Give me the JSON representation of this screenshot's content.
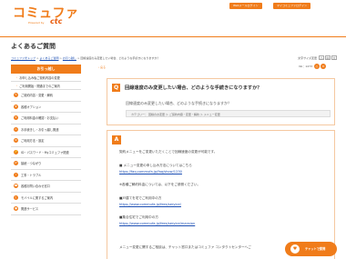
{
  "header": {
    "logo_text": "コミュファ",
    "logo_sub": "Powered by",
    "logo_ctc": "ctc",
    "link_web": "Webメールログイン",
    "link_commufa": "マイコミュファログイン"
  },
  "page_title": "よくあるご質問",
  "breadcrumb": {
    "items": [
      "コミュファ光トップ",
      "よくあるご質問",
      "お引っ越し",
      "回線速度のみ変更したい場合、どのような手続きになりますか？"
    ],
    "font_size_label": "文字サイズ変更",
    "fs_small": "小",
    "fs_mid": "中",
    "fs_large": "大"
  },
  "sidebar": {
    "heading": "お引っ越し",
    "items": [
      {
        "label": "お申し込み後ご契約内容の変更",
        "sub": true
      },
      {
        "label": "ご利用開始・開通までのご案内",
        "sub": true
      },
      {
        "label": "ご契約内容・変更・解約",
        "icon": "✎"
      },
      {
        "label": "各種オプション",
        "icon": "★"
      },
      {
        "label": "ご利用料金の確認・お支払い",
        "icon": "¥"
      },
      {
        "label": "お手続きし・お引っ越し関連",
        "icon": "⌂"
      },
      {
        "label": "ご利用方法・設定",
        "icon": "⚙"
      },
      {
        "label": "ID・パスワード・Myコミュファ関連",
        "icon": "🔑"
      },
      {
        "label": "接続・つながり",
        "icon": "⇄"
      },
      {
        "label": "工事・トラブル",
        "icon": "!"
      },
      {
        "label": "各種お問い合わせ窓口",
        "icon": "☎"
      },
      {
        "label": "モバイルに関するご案内",
        "icon": "▯"
      },
      {
        "label": "関連サービス",
        "icon": "●"
      }
    ]
  },
  "main": {
    "back": "戻る",
    "no_label": "No：1473",
    "question": "回線速度のみ変更したい場合、どのような手続きになりますか？",
    "question_sub": "回線速度のみ変更したい場合、どのような手続きになりますか？",
    "category": "カテゴリー： 回線のお変更 ＞ ご契約内容・変更・解約 ＞ メニュー変更",
    "answer_lines": [
      {
        "text": "契約メニューをご変更いただくことで回線速度の変更が可能です。",
        "link": false
      },
      {
        "text": "■ メニュー変更の申し込み方法についてはこちら",
        "link": false
      },
      {
        "text": "https://faq.commufa.jp/faq/show/1230",
        "link": true
      },
      {
        "text": "※各種ご解約料金については、以下をご参照ください。",
        "link": false
      },
      {
        "text": "■戸建てを宅でご利用中の方",
        "link": false
      },
      {
        "text": "https://www.commufa.jp/fees/service/",
        "link": true
      },
      {
        "text": "■集合住宅でご利用中の方",
        "link": false
      },
      {
        "text": "https://www.commufa.jp/fees/service/mansion",
        "link": true
      },
      {
        "text": "メニュー変更に関するご相談は、チャット窓口またはコミュファ コンタクトセンターへご",
        "link": false
      }
    ],
    "answer_badge": "A",
    "question_badge": "Q"
  },
  "chat": {
    "label": "チャットで質問",
    "icon": "♥"
  },
  "colors": {
    "accent": "#f07c1a",
    "link": "#1a4db3"
  }
}
